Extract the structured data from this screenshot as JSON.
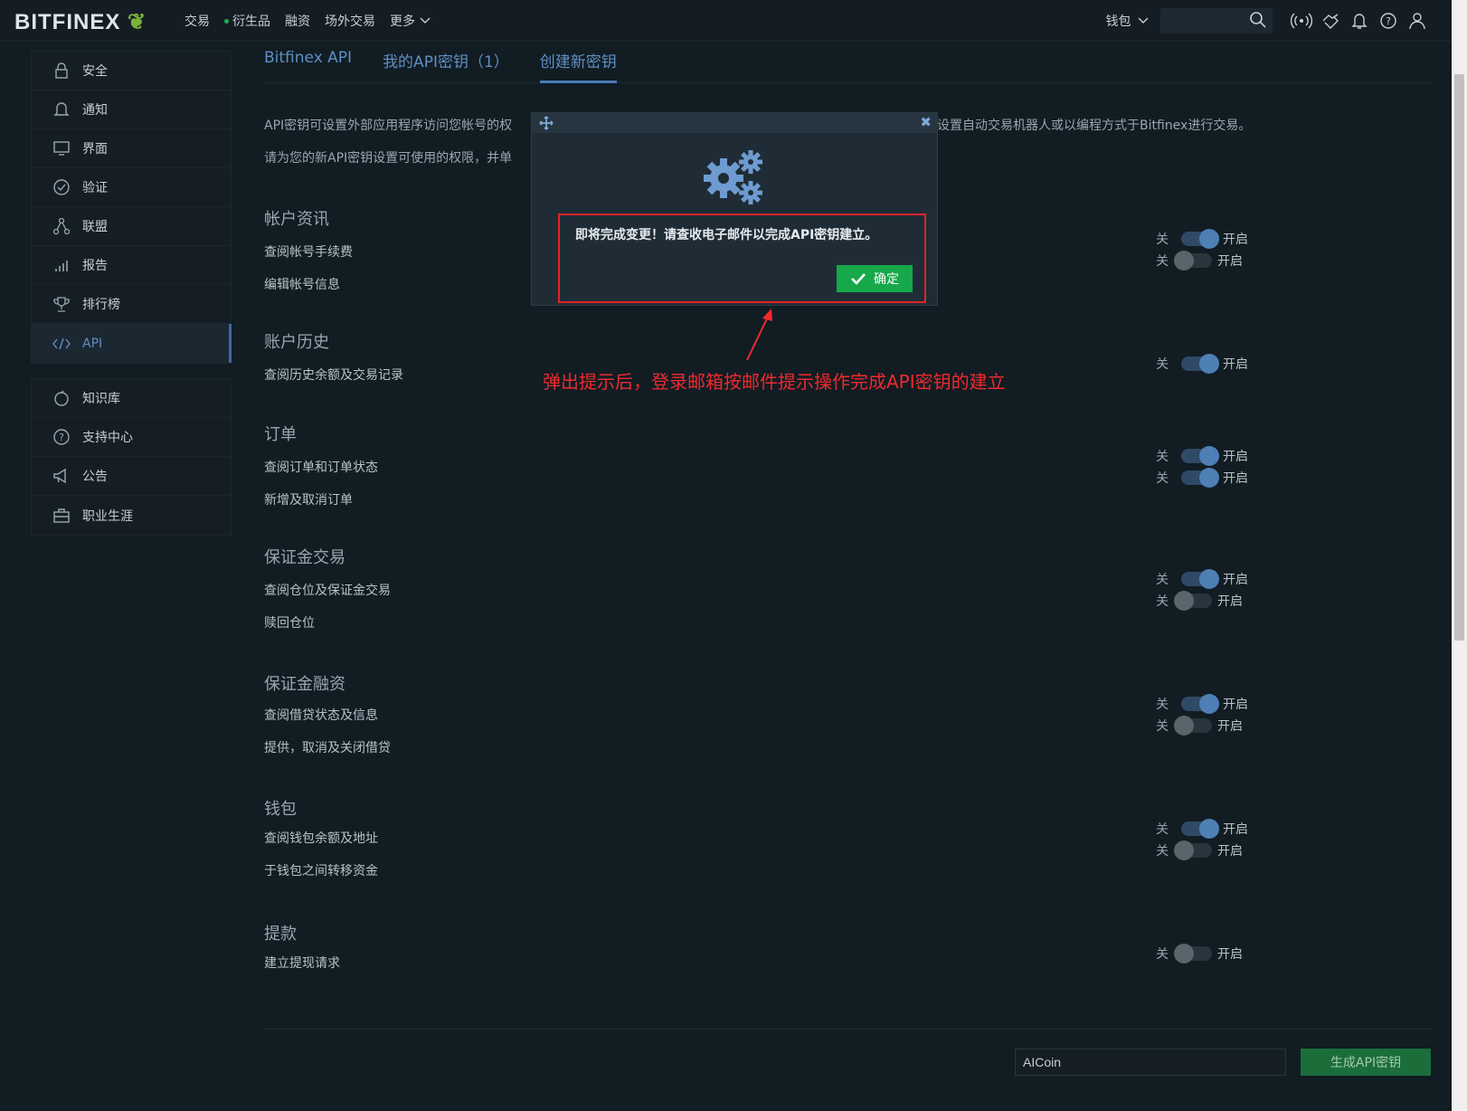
{
  "topbar": {
    "logo": "BITFINEX",
    "nav": [
      "交易",
      "衍生品",
      "融资",
      "场外交易",
      "更多"
    ],
    "wallet": "钱包"
  },
  "sidebar": {
    "group1": [
      "安全",
      "通知",
      "界面",
      "验证",
      "联盟",
      "报告",
      "排行榜",
      "API"
    ],
    "group2": [
      "知识库",
      "支持中心",
      "公告",
      "职业生涯"
    ]
  },
  "tabs": [
    "Bitfinex API",
    "我的API密钥（1）",
    "创建新密钥"
  ],
  "desc1_a": "API密钥可设置外部应用程序访问您帐号的权",
  "desc1_b": "设置自动交易机器人或以编程方式于Bitfinex进行交易。",
  "desc2": "请为您的新API密钥设置可使用的权限，并单",
  "toggle_off": "关",
  "toggle_on": "开启",
  "sections": [
    {
      "title": "帐户资讯",
      "perms": [
        "查阅帐号手续费",
        "编辑帐号信息"
      ],
      "states": [
        true,
        false
      ]
    },
    {
      "title": "账户历史",
      "perms": [
        "查阅历史余额及交易记录"
      ],
      "states": [
        true
      ]
    },
    {
      "title": "订单",
      "perms": [
        "查阅订单和订单状态",
        "新增及取消订单"
      ],
      "states": [
        true,
        true
      ]
    },
    {
      "title": "保证金交易",
      "perms": [
        "查阅仓位及保证金交易",
        "赎回仓位"
      ],
      "states": [
        true,
        false
      ]
    },
    {
      "title": "保证金融资",
      "perms": [
        "查阅借贷状态及信息",
        "提供，取消及关闭借贷"
      ],
      "states": [
        true,
        false
      ]
    },
    {
      "title": "钱包",
      "perms": [
        "查阅钱包余额及地址",
        "于钱包之间转移资金"
      ],
      "states": [
        true,
        false
      ]
    },
    {
      "title": "提款",
      "perms": [
        "建立提现请求"
      ],
      "states": [
        false
      ]
    }
  ],
  "footer": {
    "label_value": "AICoin",
    "generate_label": "生成API密钥"
  },
  "modal": {
    "message": "即将完成变更！请查收电子邮件以完成API密钥建立。",
    "ok_label": "确定",
    "close_glyph": "✖"
  },
  "annotation": "弹出提示后，登录邮箱按邮件提示操作完成API密钥的建立"
}
